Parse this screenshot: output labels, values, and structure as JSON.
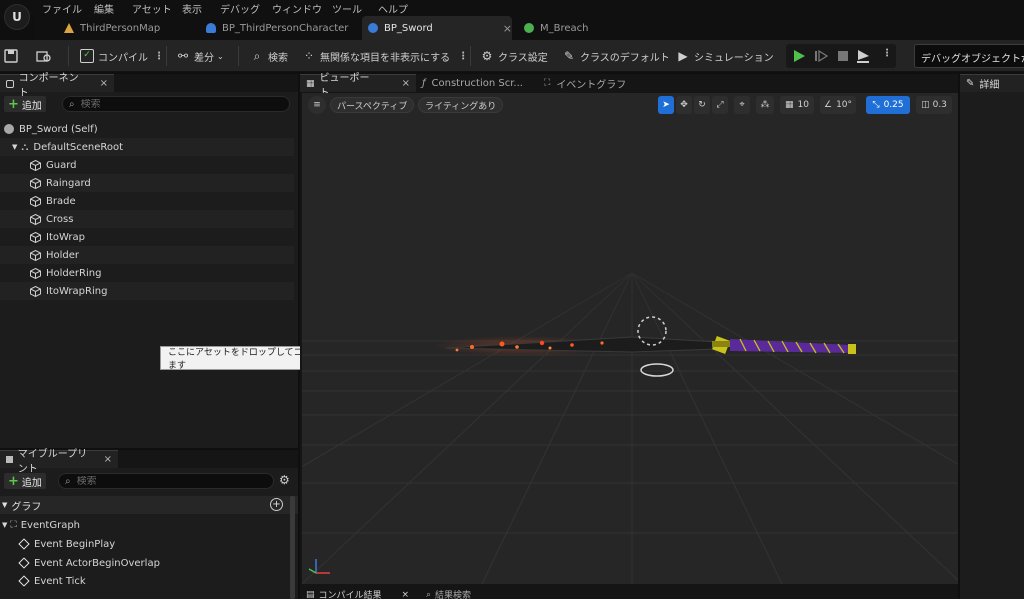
{
  "app": {
    "logo_text": "U",
    "menu": [
      "ファイル",
      "編集",
      "アセット",
      "表示",
      "デバッグ",
      "ウィンドウ",
      "ツール",
      "ヘルプ"
    ]
  },
  "doc_tabs": [
    {
      "label": "ThirdPersonMap",
      "icon": "level-icon",
      "color": "#d9a441"
    },
    {
      "label": "BP_ThirdPersonCharacter",
      "icon": "character-blueprint-icon",
      "color": "#3a7bd5"
    },
    {
      "label": "BP_Sword",
      "icon": "actor-blueprint-icon",
      "color": "#3a7bd5",
      "active": true,
      "close": "×"
    },
    {
      "label": "M_Breach",
      "icon": "material-icon",
      "color": "#4caf50"
    }
  ],
  "toolbar": {
    "compile": "コンパイル",
    "diff": "差分",
    "search": "検索",
    "hide_unrelated": "無関係な項目を非表示にする",
    "class_settings": "クラス設定",
    "class_defaults": "クラスのデフォルト",
    "simulation": "シミュレーション",
    "debug_object": "デバッグオブジェクトが選"
  },
  "components_panel": {
    "tab_label": "コンポーネント",
    "close": "×",
    "add_label": "追加",
    "search_placeholder": "検索",
    "root_item": "BP_Sword (Self)",
    "scene_root": "DefaultSceneRoot",
    "children": [
      "Guard",
      "Raingard",
      "Brade",
      "Cross",
      "ItoWrap",
      "Holder",
      "HolderRing",
      "ItoWrapRing"
    ]
  },
  "tooltip": "ここにアセットをドロップしてコンポーネントを追加します",
  "my_blueprint": {
    "tab_label": "マイブループリント",
    "close": "×",
    "add_label": "追加",
    "search_placeholder": "検索",
    "graph_section": "グラフ",
    "event_graph": "EventGraph",
    "events": [
      "Event BeginPlay",
      "Event ActorBeginOverlap",
      "Event Tick"
    ]
  },
  "viewport": {
    "tabs": [
      {
        "label": "ビューポート",
        "close": "×",
        "active": true
      },
      {
        "label": "Construction Scr...",
        "active": false
      },
      {
        "label": "イベントグラフ",
        "active": false
      }
    ],
    "perspective": "パースペクティブ",
    "lighting": "ライティングあり",
    "grid_snap": "10",
    "rotation_snap": "10°",
    "scale_snap": "0.25",
    "camera_speed": "0.3"
  },
  "bottom_tabs": {
    "compile_results": "コンパイル結果",
    "find_results": "結果検索",
    "close": "×"
  },
  "details_panel": {
    "tab_label": "詳細"
  },
  "colors": {
    "accent_blue": "#1f6fd6",
    "play_green": "#4fc14a",
    "add_green": "#5cc84a",
    "sword_handle_purple": "#5b2a9a",
    "sword_guard_yellow": "#c9c21a"
  }
}
